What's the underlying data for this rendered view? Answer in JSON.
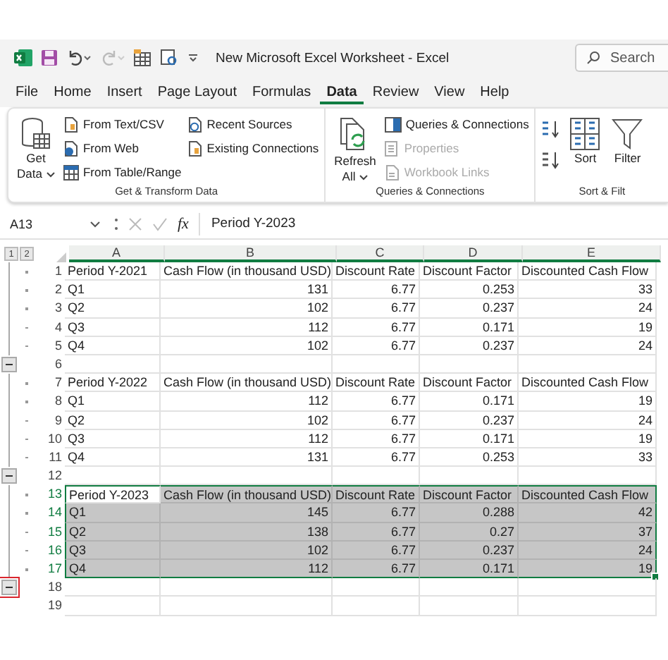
{
  "title_bar": {
    "title": "New Microsoft Excel Worksheet  -  Excel",
    "search": {
      "placeholder": "Search"
    }
  },
  "tabs": [
    {
      "label": "File",
      "selected": false
    },
    {
      "label": "Home",
      "selected": false
    },
    {
      "label": "Insert",
      "selected": false
    },
    {
      "label": "Page Layout",
      "selected": false
    },
    {
      "label": "Formulas",
      "selected": false
    },
    {
      "label": "Data",
      "selected": true
    },
    {
      "label": "Review",
      "selected": false
    },
    {
      "label": "View",
      "selected": false
    },
    {
      "label": "Help",
      "selected": false
    }
  ],
  "ribbon": [
    {
      "label": "Get & Transform Data",
      "columns": [
        {
          "kind": "large",
          "lines": [
            "Get",
            "Data"
          ],
          "dropdown": true
        },
        {
          "kind": "stack",
          "items": [
            {
              "label": "From Text/CSV",
              "disabled": false
            },
            {
              "label": "From Web",
              "disabled": false
            },
            {
              "label": "From Table/Range",
              "disabled": false
            }
          ]
        },
        {
          "kind": "stack",
          "items": [
            {
              "label": "Recent Sources",
              "disabled": false
            },
            {
              "label": "Existing Connections",
              "disabled": false
            }
          ]
        }
      ]
    },
    {
      "label": "Queries & Connections",
      "columns": [
        {
          "kind": "large",
          "lines": [
            "Refresh",
            "All"
          ],
          "dropdown": true
        },
        {
          "kind": "stack",
          "items": [
            {
              "label": "Queries & Connections",
              "disabled": false
            },
            {
              "label": "Properties",
              "disabled": true
            },
            {
              "label": "Workbook Links",
              "disabled": true
            }
          ]
        }
      ]
    },
    {
      "label": "Sort & Filt",
      "columns": [
        {
          "kind": "sorticons"
        },
        {
          "kind": "large",
          "lines": [
            "Sort"
          ],
          "dropdown": false
        },
        {
          "kind": "large",
          "lines": [
            "Filter"
          ],
          "dropdown": false
        }
      ]
    }
  ],
  "formula_bar": {
    "name_box": "A13",
    "fx": "fx",
    "value": "Period Y-2023"
  },
  "outline_levels": [
    "1",
    "2"
  ],
  "columns": [
    {
      "label": "A",
      "selected": true
    },
    {
      "label": "B",
      "selected": true
    },
    {
      "label": "C",
      "selected": true
    },
    {
      "label": "D",
      "selected": true
    },
    {
      "label": "E",
      "selected": true
    }
  ],
  "rows": [
    {
      "number": "1",
      "kind": "header",
      "grouped": true,
      "selected": false,
      "cells": [
        "Period Y-2021",
        "Cash Flow (in thousand USD)",
        "Discount Rate",
        "Discount Factor",
        "Discounted Cash Flow"
      ]
    },
    {
      "number": "2",
      "kind": "data",
      "grouped": true,
      "selected": false,
      "cells": [
        "Q1",
        "131",
        "6.77",
        "0.253",
        "33"
      ]
    },
    {
      "number": "3",
      "kind": "data",
      "grouped": true,
      "selected": false,
      "cells": [
        "Q2",
        "102",
        "6.77",
        "0.237",
        "24"
      ]
    },
    {
      "number": "4",
      "kind": "data",
      "grouped": true,
      "selected": false,
      "cells": [
        "Q3",
        "112",
        "6.77",
        "0.171",
        "19"
      ]
    },
    {
      "number": "5",
      "kind": "data",
      "grouped": true,
      "selected": false,
      "cells": [
        "Q4",
        "102",
        "6.77",
        "0.237",
        "24"
      ]
    },
    {
      "number": "6",
      "kind": "empty",
      "group_end": true,
      "selected": false
    },
    {
      "number": "7",
      "kind": "header",
      "grouped": true,
      "selected": false,
      "cells": [
        "Period Y-2022",
        "Cash Flow (in thousand USD)",
        "Discount Rate",
        "Discount Factor",
        "Discounted Cash Flow"
      ]
    },
    {
      "number": "8",
      "kind": "data",
      "grouped": true,
      "selected": false,
      "cells": [
        "Q1",
        "112",
        "6.77",
        "0.171",
        "19"
      ]
    },
    {
      "number": "9",
      "kind": "data",
      "grouped": true,
      "selected": false,
      "cells": [
        "Q2",
        "102",
        "6.77",
        "0.237",
        "24"
      ]
    },
    {
      "number": "10",
      "kind": "data",
      "grouped": true,
      "selected": false,
      "cells": [
        "Q3",
        "112",
        "6.77",
        "0.171",
        "19"
      ]
    },
    {
      "number": "11",
      "kind": "data",
      "grouped": true,
      "selected": false,
      "cells": [
        "Q4",
        "131",
        "6.77",
        "0.253",
        "33"
      ]
    },
    {
      "number": "12",
      "kind": "empty",
      "group_end": true,
      "selected": false
    },
    {
      "number": "13",
      "kind": "header",
      "grouped": true,
      "selected": true,
      "active": true,
      "cells": [
        "Period Y-2023",
        "Cash Flow (in thousand USD)",
        "Discount Rate",
        "Discount Factor",
        "Discounted Cash Flow"
      ]
    },
    {
      "number": "14",
      "kind": "data",
      "grouped": true,
      "selected": true,
      "cells": [
        "Q1",
        "145",
        "6.77",
        "0.288",
        "42"
      ]
    },
    {
      "number": "15",
      "kind": "data",
      "grouped": true,
      "selected": true,
      "cells": [
        "Q2",
        "138",
        "6.77",
        "0.27",
        "37"
      ]
    },
    {
      "number": "16",
      "kind": "data",
      "grouped": true,
      "selected": true,
      "cells": [
        "Q3",
        "102",
        "6.77",
        "0.237",
        "24"
      ]
    },
    {
      "number": "17",
      "kind": "data",
      "grouped": true,
      "selected": true,
      "cells": [
        "Q4",
        "112",
        "6.77",
        "0.171",
        "19"
      ]
    },
    {
      "number": "18",
      "kind": "empty",
      "group_end": true,
      "highlighted": true,
      "selected": false
    },
    {
      "number": "19",
      "kind": "empty",
      "selected": false
    }
  ]
}
